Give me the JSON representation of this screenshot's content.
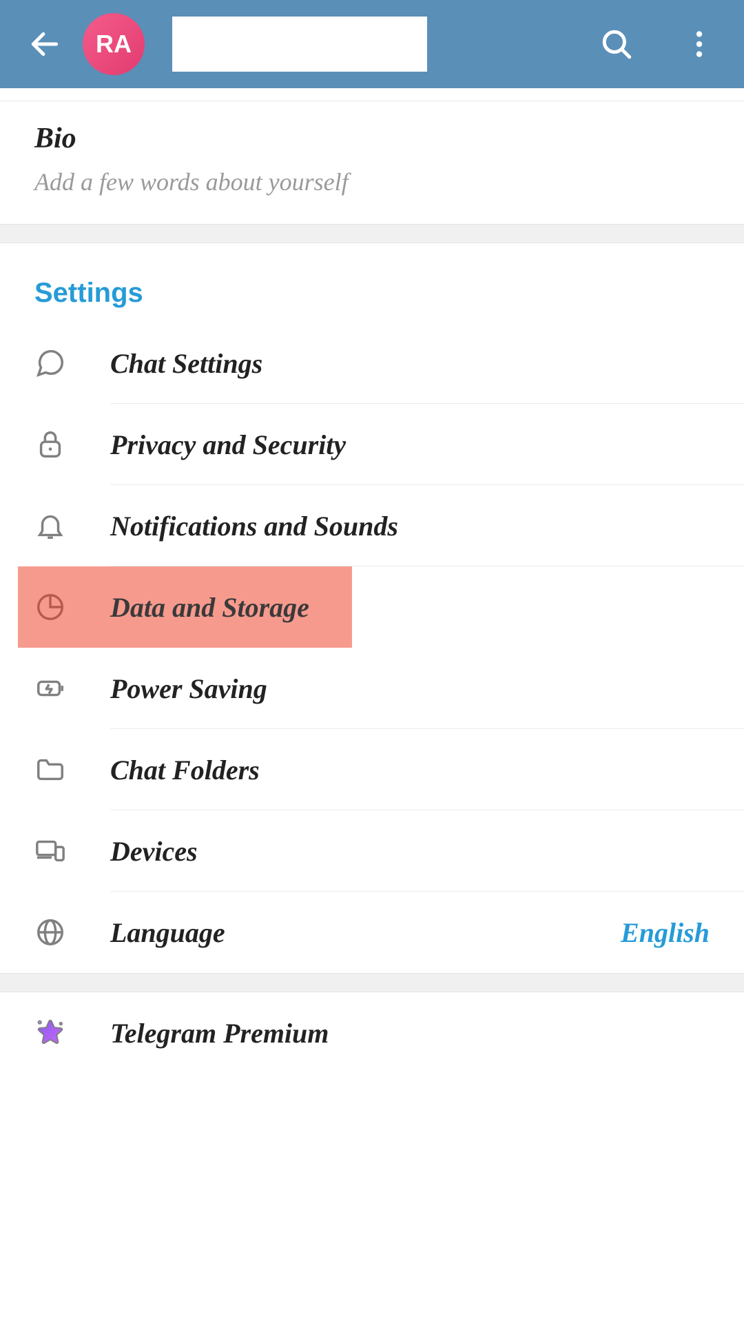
{
  "header": {
    "avatar_initials": "RA"
  },
  "bio": {
    "title": "Bio",
    "hint": "Add a few words about yourself"
  },
  "settings": {
    "section_title": "Settings",
    "items": [
      {
        "label": "Chat Settings",
        "icon": "chat-icon"
      },
      {
        "label": "Privacy and Security",
        "icon": "lock-icon"
      },
      {
        "label": "Notifications and Sounds",
        "icon": "bell-icon"
      },
      {
        "label": "Data and Storage",
        "icon": "pie-icon",
        "highlighted": true
      },
      {
        "label": "Power Saving",
        "icon": "battery-icon"
      },
      {
        "label": "Chat Folders",
        "icon": "folder-icon"
      },
      {
        "label": "Devices",
        "icon": "devices-icon"
      },
      {
        "label": "Language",
        "icon": "globe-icon",
        "value": "English"
      }
    ]
  },
  "premium": {
    "label": "Telegram Premium"
  }
}
